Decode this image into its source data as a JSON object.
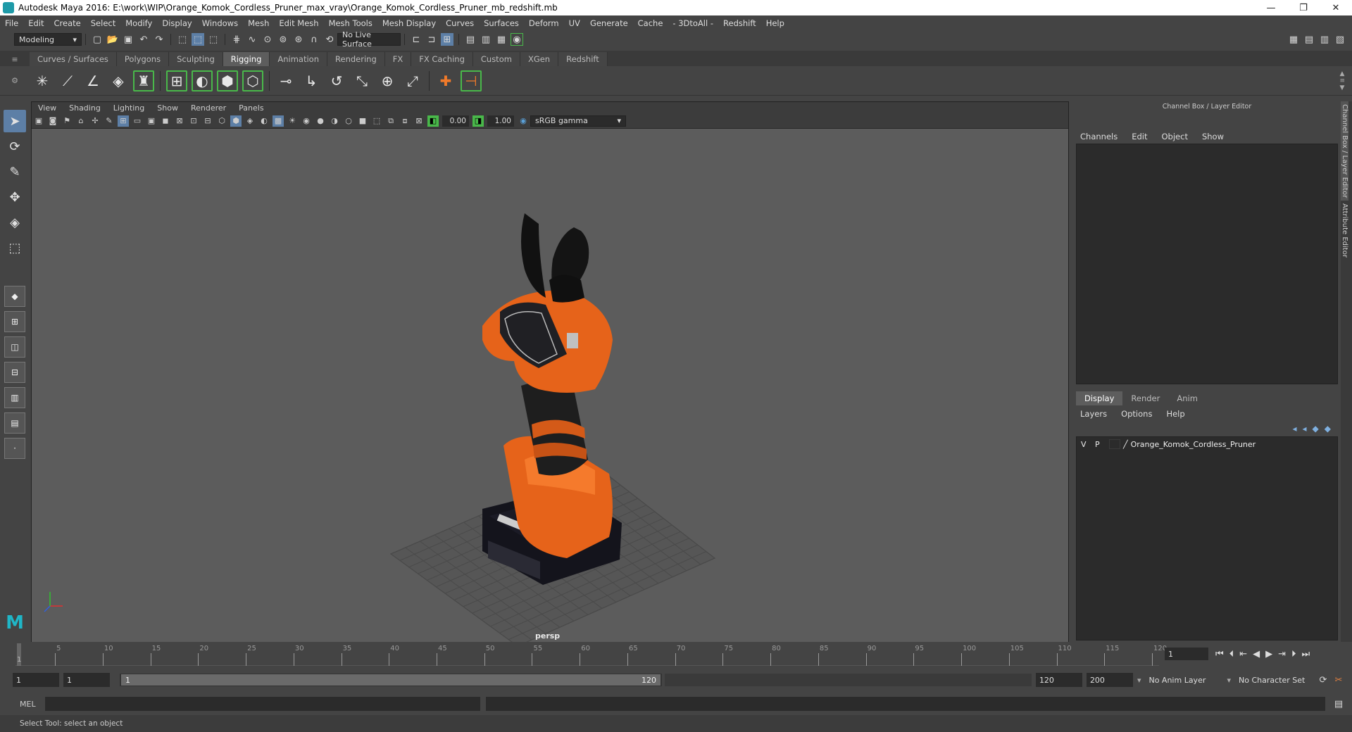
{
  "window": {
    "title": "Autodesk Maya 2016: E:\\work\\WIP\\Orange_Komok_Cordless_Pruner_max_vray\\Orange_Komok_Cordless_Pruner_mb_redshift.mb",
    "minimize": "—",
    "restore": "❐",
    "close": "✕"
  },
  "menubar": [
    "File",
    "Edit",
    "Create",
    "Select",
    "Modify",
    "Display",
    "Windows",
    "Mesh",
    "Edit Mesh",
    "Mesh Tools",
    "Mesh Display",
    "Curves",
    "Surfaces",
    "Deform",
    "UV",
    "Generate",
    "Cache",
    "- 3DtoAll -",
    "Redshift",
    "Help"
  ],
  "statusline": {
    "menuset": "Modeling",
    "live_surface": "No Live Surface"
  },
  "shelf": {
    "tabs": [
      "Curves / Surfaces",
      "Polygons",
      "Sculpting",
      "Rigging",
      "Animation",
      "Rendering",
      "FX",
      "FX Caching",
      "Custom",
      "XGen",
      "Redshift"
    ],
    "active_tab": "Rigging"
  },
  "viewport": {
    "menu": [
      "View",
      "Shading",
      "Lighting",
      "Show",
      "Renderer",
      "Panels"
    ],
    "exposure": "0.00",
    "gamma": "1.00",
    "colorspace": "sRGB gamma",
    "camera_label": "persp"
  },
  "right_panel": {
    "title": "Channel Box / Layer Editor",
    "channel_menu": [
      "Channels",
      "Edit",
      "Object",
      "Show"
    ],
    "layer_tabs": [
      "Display",
      "Render",
      "Anim"
    ],
    "active_layer_tab": "Display",
    "layer_menu": [
      "Layers",
      "Options",
      "Help"
    ],
    "layers": [
      {
        "v": "V",
        "p": "P",
        "name": "Orange_Komok_Cordless_Pruner"
      }
    ],
    "side_tabs": [
      "Channel Box / Layer Editor",
      "Attribute Editor"
    ]
  },
  "timeline": {
    "start_marker": "1",
    "ticks": [
      "5",
      "10",
      "15",
      "20",
      "25",
      "30",
      "35",
      "40",
      "45",
      "50",
      "55",
      "60",
      "65",
      "70",
      "75",
      "80",
      "85",
      "90",
      "95",
      "100",
      "105",
      "110",
      "115",
      "120"
    ],
    "current_frame": "1"
  },
  "range": {
    "start": "1",
    "playback_start": "1",
    "slider_start": "1",
    "slider_end": "120",
    "playback_end": "120",
    "end": "200",
    "anim_layer": "No Anim Layer",
    "character_set": "No Character Set"
  },
  "command": {
    "label": "MEL"
  },
  "helpline": "Select Tool: select an object"
}
